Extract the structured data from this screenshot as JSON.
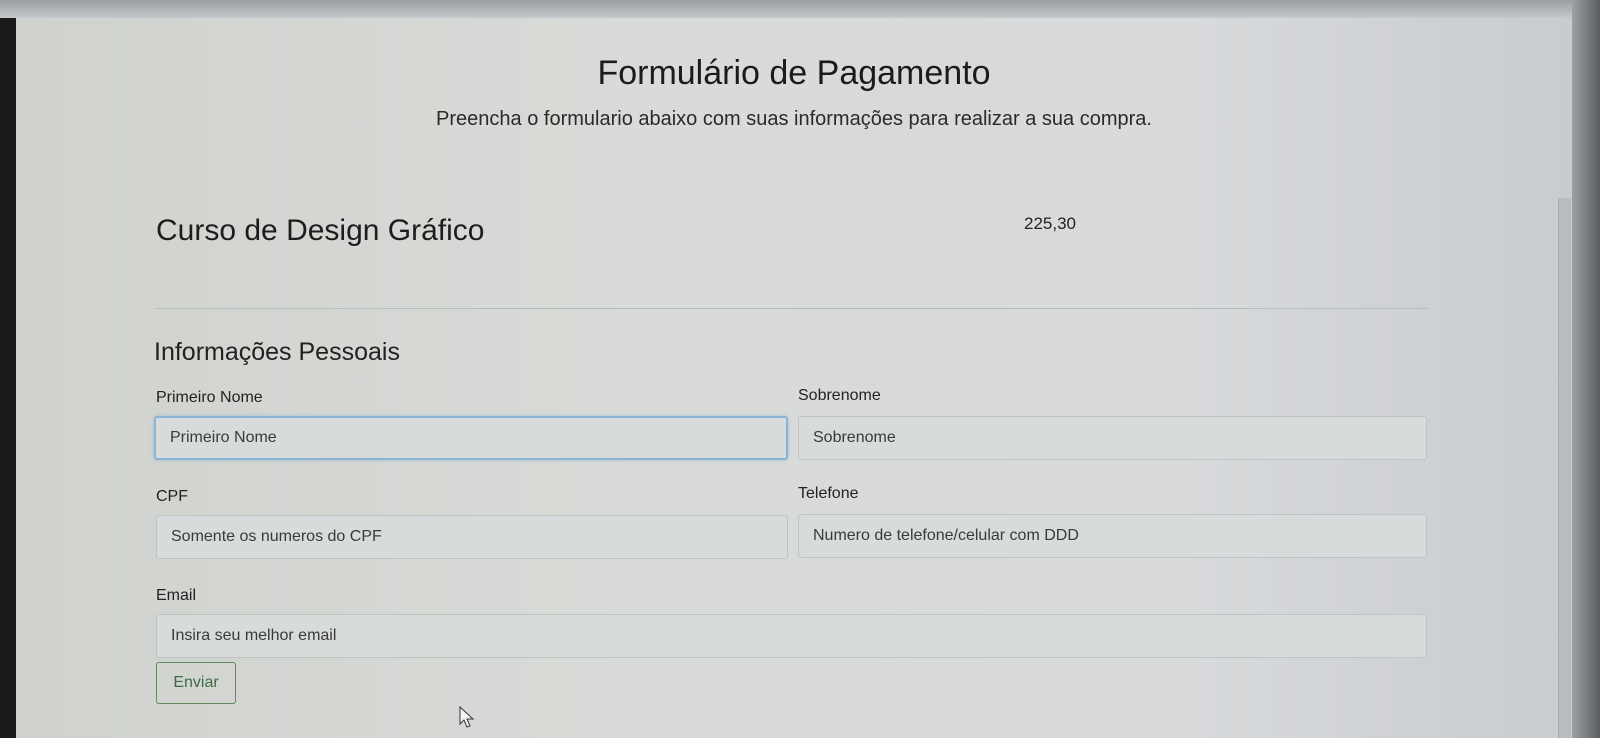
{
  "page": {
    "title": "Formulário de Pagamento",
    "subtitle": "Preencha o formulario abaixo com suas informações para realizar a sua compra."
  },
  "product": {
    "name": "Curso de Design Gráfico",
    "price": "225,30"
  },
  "personal_info": {
    "section_title": "Informações Pessoais",
    "first_name": {
      "label": "Primeiro Nome",
      "placeholder": "Primeiro Nome",
      "value": ""
    },
    "last_name": {
      "label": "Sobrenome",
      "placeholder": "Sobrenome",
      "value": ""
    },
    "cpf": {
      "label": "CPF",
      "placeholder": "Somente os numeros do CPF",
      "value": ""
    },
    "phone": {
      "label": "Telefone",
      "placeholder": "Numero de telefone/celular com DDD",
      "value": ""
    },
    "email": {
      "label": "Email",
      "placeholder": "Insira seu melhor email",
      "value": ""
    }
  },
  "actions": {
    "submit_label": "Enviar"
  },
  "colors": {
    "focus_border": "#8ab3d6",
    "submit_border": "#5f8a62",
    "submit_text": "#3f6b42"
  }
}
